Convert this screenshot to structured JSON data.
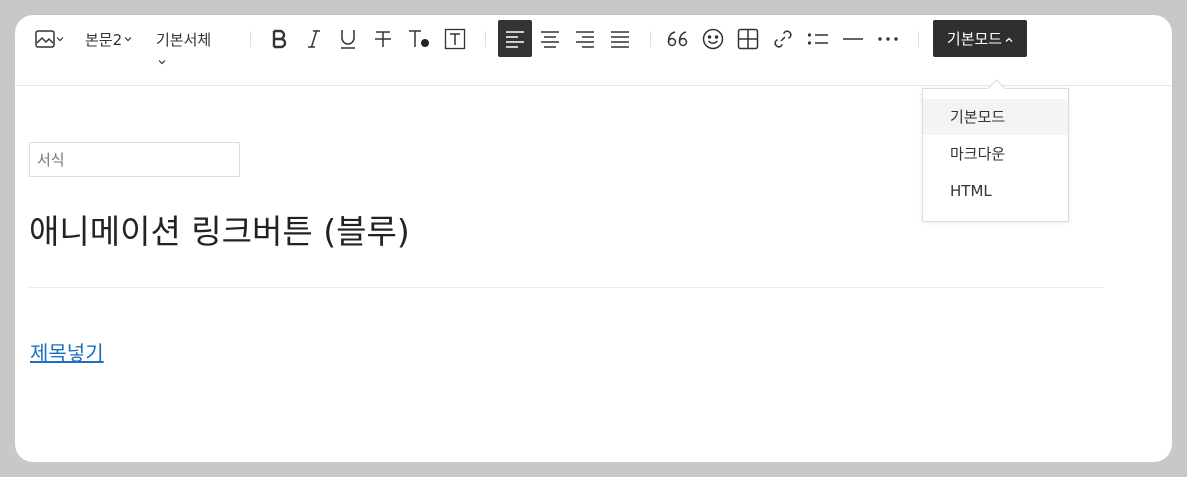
{
  "toolbar": {
    "paragraph_style": "본문2",
    "font_family": "기본서체",
    "mode_button_label": "기본모드",
    "icons": [
      "image-icon",
      "bold-icon",
      "italic-icon",
      "underline-icon",
      "strikethrough-icon",
      "text-color-icon",
      "text-background-icon",
      "align-left-icon",
      "align-center-icon",
      "align-right-icon",
      "align-justify-icon",
      "quote-icon",
      "emoji-icon",
      "table-icon",
      "link-icon",
      "bullet-list-icon",
      "horizontal-rule-icon",
      "more-icon"
    ]
  },
  "mode_dropdown": {
    "items": [
      {
        "label": "기본모드",
        "selected": true
      },
      {
        "label": "마크다운",
        "selected": false
      },
      {
        "label": "HTML",
        "selected": false
      }
    ]
  },
  "editor": {
    "style_placeholder": "서식",
    "title": "애니메이션 링크버튼 (블루)",
    "link_text": "제목넣기"
  },
  "colors": {
    "link": "#1a6fc0",
    "dark_button": "#2f2f2f",
    "backdrop": "#c8c8c8"
  }
}
